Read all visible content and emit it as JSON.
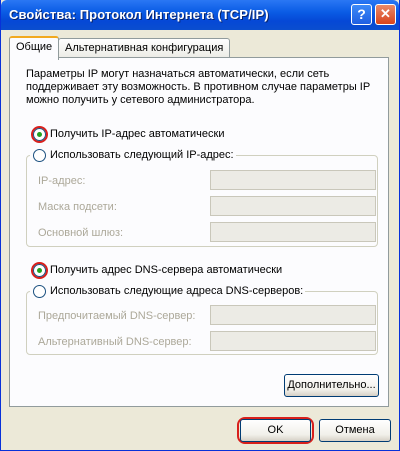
{
  "window": {
    "title": "Свойства: Протокол Интернета (TCP/IP)",
    "help_glyph": "?",
    "close_glyph": "✕"
  },
  "tabs": [
    {
      "label": "Общие",
      "active": true
    },
    {
      "label": "Альтернативная конфигурация",
      "active": false
    }
  ],
  "info_text": "Параметры IP могут назначаться автоматически, если сеть поддерживает эту возможность. В противном случае параметры IP можно получить у сетевого администратора.",
  "ip": {
    "auto_label": "Получить IP-адрес автоматически",
    "manual_label": "Использовать следующий IP-адрес:",
    "selected": "auto",
    "fields": [
      {
        "label": "IP-адрес:",
        "value": ""
      },
      {
        "label": "Маска подсети:",
        "value": ""
      },
      {
        "label": "Основной шлюз:",
        "value": ""
      }
    ]
  },
  "dns": {
    "auto_label": "Получить адрес DNS-сервера автоматически",
    "manual_label": "Использовать следующие адреса DNS-серверов:",
    "selected": "auto",
    "fields": [
      {
        "label": "Предпочитаемый DNS-сервер:",
        "value": ""
      },
      {
        "label": "Альтернативный DNS-сервер:",
        "value": ""
      }
    ]
  },
  "buttons": {
    "advanced": "Дополнительно...",
    "ok": "OK",
    "cancel": "Отмена"
  },
  "colors": {
    "highlight": "#d8201c",
    "title_bar": "#0a5ce5",
    "radio_dot": "#21a121"
  }
}
